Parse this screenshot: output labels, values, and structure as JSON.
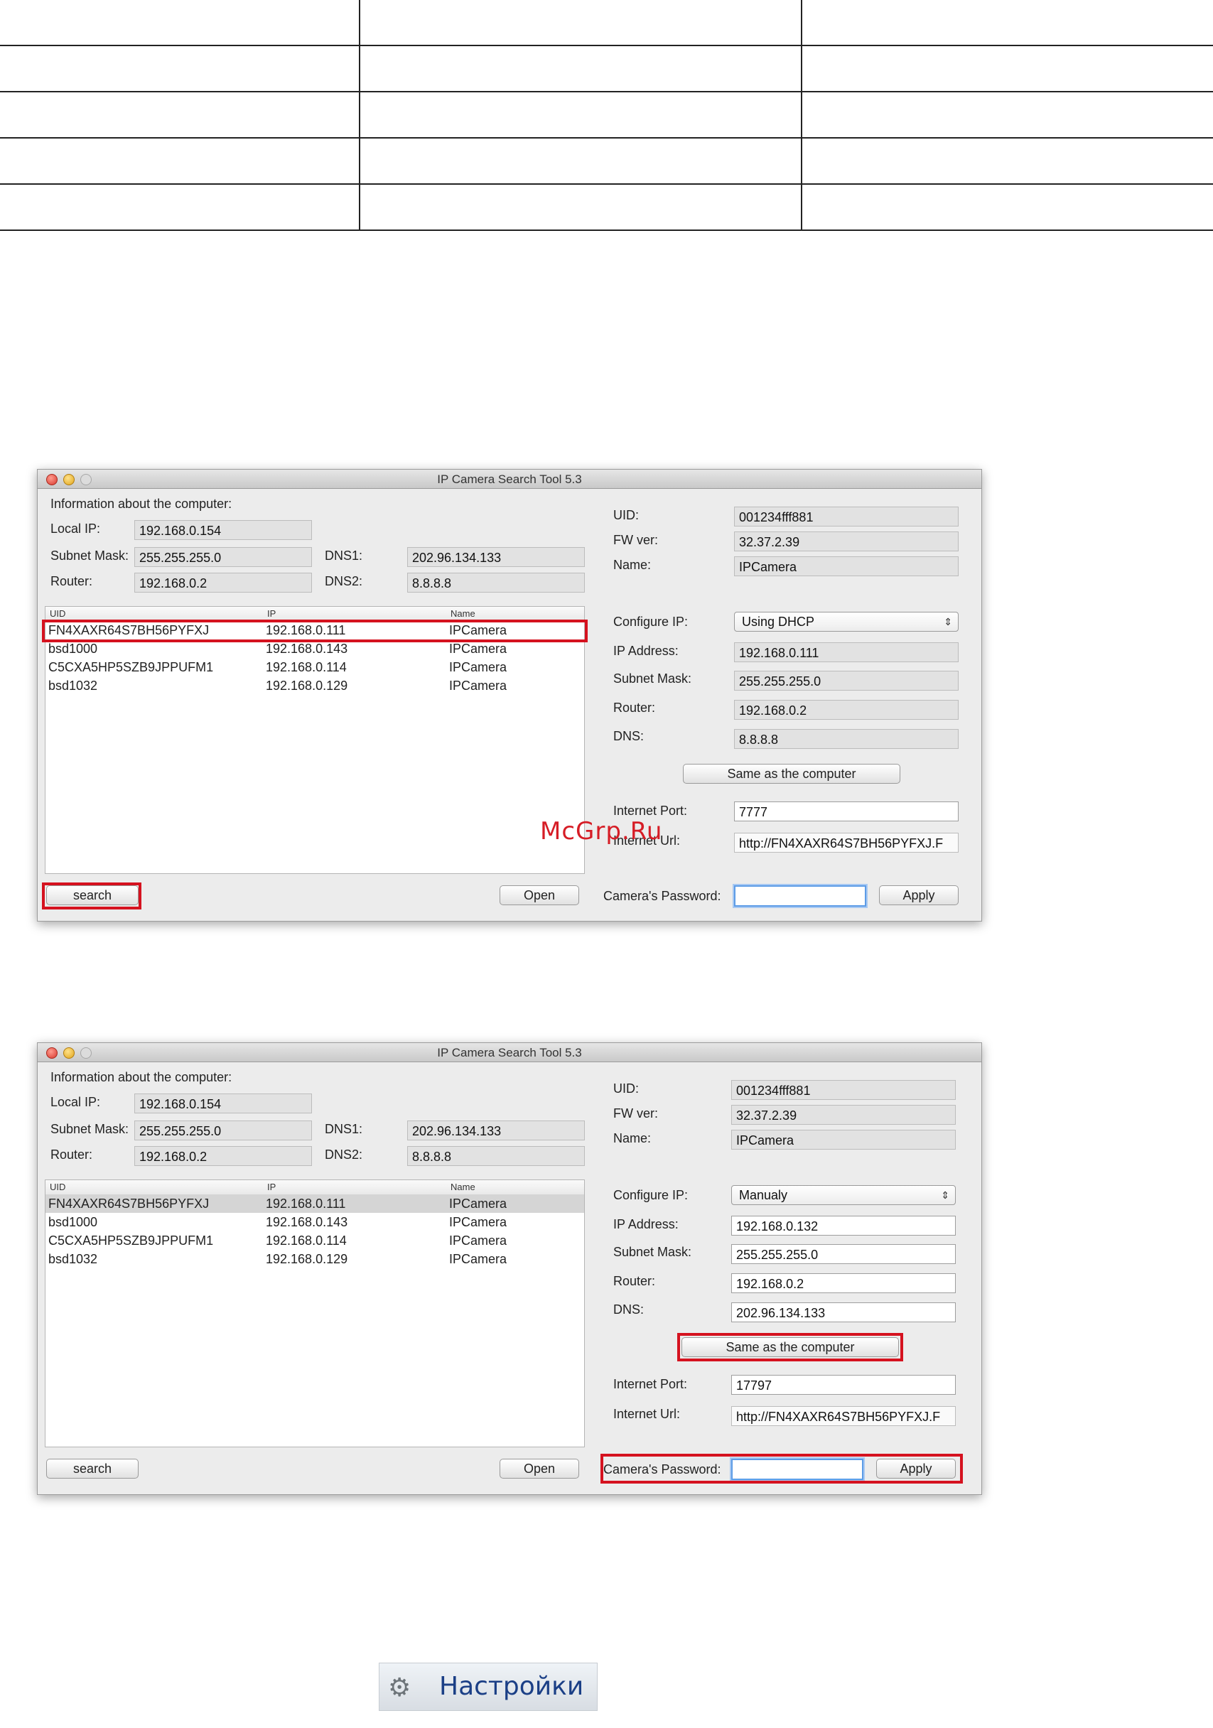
{
  "window": {
    "title": "IP Camera Search Tool 5.3",
    "computer_info_heading": "Information about the computer:",
    "labels": {
      "local_ip": "Local IP:",
      "subnet_mask": "Subnet Mask:",
      "router": "Router:",
      "dns1": "DNS1:",
      "dns2": "DNS2:",
      "uid": "UID:",
      "fw_ver": "FW ver:",
      "name": "Name:",
      "configure_ip": "Configure IP:",
      "ip_address": "IP Address:",
      "subnet_mask_right": "Subnet Mask:",
      "router_right": "Router:",
      "dns": "DNS:",
      "internet_port": "Internet Port:",
      "internet_url": "Internet Url:",
      "camera_password": "Camera's Password:"
    },
    "buttons": {
      "same_as_computer": "Same as the computer",
      "search": "search",
      "open": "Open",
      "apply": "Apply"
    },
    "list_columns": [
      "UID",
      "IP",
      "Name"
    ],
    "devices": [
      {
        "uid": "FN4XAXR64S7BH56PYFXJ",
        "ip": "192.168.0.111",
        "name": "IPCamera"
      },
      {
        "uid": "bsd1000",
        "ip": "192.168.0.143",
        "name": "IPCamera"
      },
      {
        "uid": "C5CXA5HP5SZB9JPPUFM1",
        "ip": "192.168.0.114",
        "name": "IPCamera"
      },
      {
        "uid": "bsd1032",
        "ip": "192.168.0.129",
        "name": "IPCamera"
      }
    ]
  },
  "screenshots": [
    {
      "computer": {
        "local_ip": "192.168.0.154",
        "subnet_mask": "255.255.255.0",
        "router": "192.168.0.2",
        "dns1": "202.96.134.133",
        "dns2": "8.8.8.8"
      },
      "camera": {
        "uid": "001234fff881",
        "fw_ver": "32.37.2.39",
        "name": "IPCamera"
      },
      "config": {
        "mode": "Using DHCP",
        "ip_address": "192.168.0.111",
        "subnet_mask": "255.255.255.0",
        "router": "192.168.0.2",
        "dns": "8.8.8.8",
        "internet_port": "7777",
        "internet_url": "http://FN4XAXR64S7BH56PYFXJ.F",
        "password": ""
      }
    },
    {
      "computer": {
        "local_ip": "192.168.0.154",
        "subnet_mask": "255.255.255.0",
        "router": "192.168.0.2",
        "dns1": "202.96.134.133",
        "dns2": "8.8.8.8"
      },
      "camera": {
        "uid": "001234fff881",
        "fw_ver": "32.37.2.39",
        "name": "IPCamera"
      },
      "config": {
        "mode": "Manualy",
        "ip_address": "192.168.0.132",
        "subnet_mask": "255.255.255.0",
        "router": "192.168.0.2",
        "dns": "202.96.134.133",
        "internet_port": "17797",
        "internet_url": "http://FN4XAXR64S7BH56PYFXJ.F",
        "password": ""
      }
    }
  ],
  "watermark": "McGrp.Ru",
  "settings_button": {
    "label": "Настройки",
    "icon": "gears-icon"
  },
  "colors": {
    "highlight": "#d5121f",
    "watermark": "#d61d26",
    "settings_text": "#1b3f86"
  }
}
